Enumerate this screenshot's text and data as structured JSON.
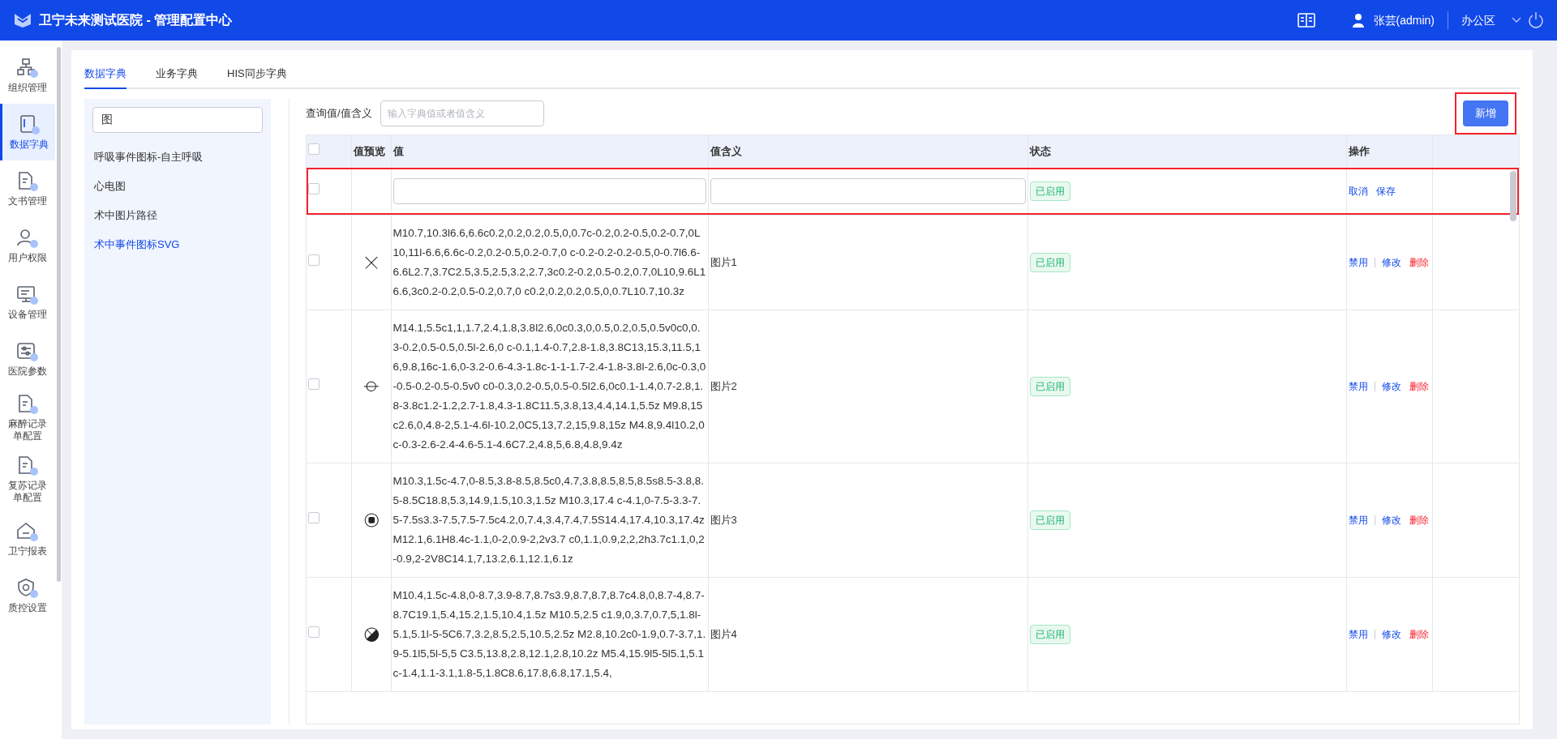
{
  "app": {
    "title": "卫宁未来测试医院 - 管理配置中心",
    "user": "张芸(admin)",
    "area": "办公区"
  },
  "nav": [
    {
      "label": "组织管理",
      "selected": false
    },
    {
      "label": "数据字典",
      "selected": true
    },
    {
      "label": "文书管理",
      "selected": false
    },
    {
      "label": "用户权限",
      "selected": false
    },
    {
      "label": "设备管理",
      "selected": false
    },
    {
      "label": "医院参数",
      "selected": false
    },
    {
      "label": "麻醉记录单配置",
      "selected": false
    },
    {
      "label": "复苏记录单配置",
      "selected": false
    },
    {
      "label": "卫宁报表",
      "selected": false
    },
    {
      "label": "质控设置",
      "selected": false
    }
  ],
  "tabs": [
    {
      "label": "数据字典",
      "selected": true
    },
    {
      "label": "业务字典",
      "selected": false
    },
    {
      "label": "HIS同步字典",
      "selected": false
    }
  ],
  "dict_search": {
    "value": "图"
  },
  "dict_list": [
    {
      "label": "呼吸事件图标-自主呼吸",
      "selected": false
    },
    {
      "label": "心电图",
      "selected": false
    },
    {
      "label": "术中图片路径",
      "selected": false
    },
    {
      "label": "术中事件图标SVG",
      "selected": true
    }
  ],
  "query": {
    "label": "查询值/值含义",
    "placeholder": "输入字典值或者值含义"
  },
  "add_button": {
    "label": "新增",
    "highlighted": true
  },
  "table": {
    "columns": [
      "值预览",
      "值",
      "值含义",
      "状态",
      "操作"
    ],
    "header_checked": false,
    "new_row": {
      "highlighted": true,
      "checked": false,
      "status": "已启用",
      "actions": [
        "取消",
        "保存"
      ]
    },
    "rows": [
      {
        "checked": false,
        "value": "M10.7,10.3l6.6,6.6c0.2,0.2,0.2,0.5,0,0.7c-0.2,0.2-0.5,0.2-0.7,0L10,11l-6.6,6.6c-0.2,0.2-0.5,0.2-0.7,0 c-0.2-0.2-0.2-0.5,0-0.7l6.6-6.6L2.7,3.7C2.5,3.5,2.5,3.2,2.7,3c0.2-0.2,0.5-0.2,0.7,0L10,9.6L16.6,3c0.2-0.2,0.5-0.2,0.7,0 c0.2,0.2,0.2,0.5,0,0.7L10.7,10.3z",
        "meaning": "图片1",
        "status": "已启用",
        "actions": [
          "禁用",
          "修改",
          "删除"
        ]
      },
      {
        "checked": false,
        "value": "M14.1,5.5c1,1,1.7,2.4,1.8,3.8l2.6,0c0.3,0,0.5,0.2,0.5,0.5v0c0,0.3-0.2,0.5-0.5,0.5l-2.6,0 c-0.1,1.4-0.7,2.8-1.8,3.8C13,15.3,11.5,16,9.8,16c-1.6,0-3.2-0.6-4.3-1.8c-1-1-1.7-2.4-1.8-3.8l-2.6,0c-0.3,0-0.5-0.2-0.5-0.5v0 c0-0.3,0.2-0.5,0.5-0.5l2.6,0c0.1-1.4,0.7-2.8,1.8-3.8c1.2-1.2,2.7-1.8,4.3-1.8C11.5,3.8,13,4.4,14.1,5.5z M9.8,15 c2.6,0,4.8-2,5.1-4.6l-10.2,0C5,13,7.2,15,9.8,15z M4.8,9.4l10.2,0c-0.3-2.6-2.4-4.6-5.1-4.6C7.2,4.8,5,6.8,4.8,9.4z",
        "meaning": "图片2",
        "status": "已启用",
        "actions": [
          "禁用",
          "修改",
          "删除"
        ]
      },
      {
        "checked": false,
        "value": "M10.3,1.5c-4.7,0-8.5,3.8-8.5,8.5c0,4.7,3.8,8.5,8.5,8.5s8.5-3.8,8.5-8.5C18.8,5.3,14.9,1.5,10.3,1.5z M10.3,17.4 c-4.1,0-7.5-3.3-7.5-7.5s3.3-7.5,7.5-7.5c4.2,0,7.4,3.4,7.4,7.5S14.4,17.4,10.3,17.4z M12.1,6.1H8.4c-1.1,0-2,0.9-2,2v3.7 c0,1.1,0.9,2,2,2h3.7c1.1,0,2-0.9,2-2V8C14.1,7,13.2,6.1,12.1,6.1z",
        "meaning": "图片3",
        "status": "已启用",
        "actions": [
          "禁用",
          "修改",
          "删除"
        ]
      },
      {
        "checked": false,
        "value": "M10.4,1.5c-4.8,0-8.7,3.9-8.7,8.7s3.9,8.7,8.7,8.7c4.8,0,8.7-4,8.7-8.7C19.1,5.4,15.2,1.5,10.4,1.5z M10.5,2.5 c1.9,0,3.7,0.7,5,1.8l-5.1,5.1l-5-5C6.7,3.2,8.5,2.5,10.5,2.5z M2.8,10.2c0-1.9,0.7-3.7,1.9-5.1l5,5l-5,5 C3.5,13.8,2.8,12.1,2.8,10.2z M5.4,15.9l5-5l5.1,5.1c-1.4,1.1-3.1,1.8-5,1.8C8.6,17.8,6.8,17.1,5.4,",
        "meaning": "图片4",
        "status": "已启用",
        "actions": [
          "禁用",
          "修改",
          "删除"
        ]
      }
    ]
  }
}
